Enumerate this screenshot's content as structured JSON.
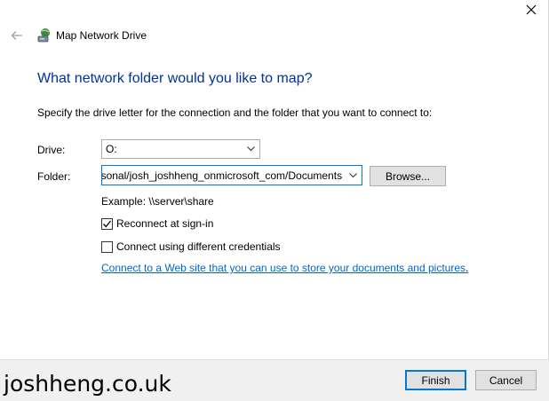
{
  "window": {
    "title": "Map Network Drive"
  },
  "icons": {
    "close": "close-icon",
    "back": "back-arrow-icon",
    "wizard": "network-drive-icon",
    "chevron": "chevron-down-icon",
    "check": "checkmark-icon"
  },
  "main": {
    "heading": "What network folder would you like to map?",
    "instruction": "Specify the drive letter for the connection and the folder that you want to connect to:",
    "drive_label": "Drive:",
    "drive_value": "O:",
    "folder_label": "Folder:",
    "folder_value": "\\\\onedrive.live.com@SSL\\personal/josh_joshheng_onmicrosoft_com/Documents",
    "browse_label": "Browse...",
    "example": "Example: \\\\server\\share",
    "reconnect_label": "Reconnect at sign-in",
    "reconnect_checked": true,
    "credentials_label": "Connect using different credentials",
    "credentials_checked": false,
    "link_text": "Connect to a Web site that you can use to store your documents and pictures",
    "link_suffix": "."
  },
  "footer": {
    "finish_label": "Finish",
    "cancel_label": "Cancel"
  },
  "watermark": "joshheng.co.uk",
  "colors": {
    "heading": "#003399",
    "link": "#0066cc",
    "focus_border": "#0078d7"
  }
}
